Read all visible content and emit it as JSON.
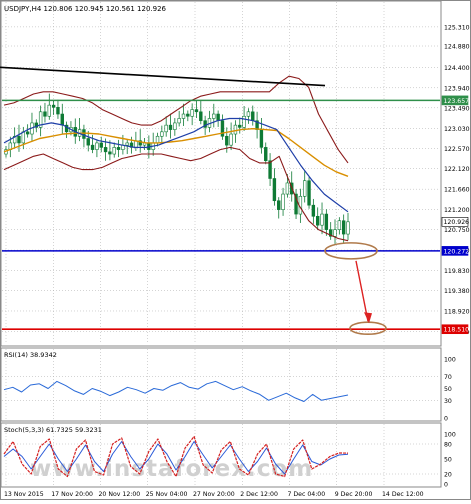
{
  "colors": {
    "background": "#ffffff",
    "grid": "#aaaaaa",
    "candle_up": "#0e7a34",
    "candle_down": "#0e7a34",
    "bollinger": "#8b1a1a",
    "ma_fast": "#1f3fa8",
    "ma_mid": "#d98f00",
    "ma_slow": "#c9a400",
    "trendline": "#000000",
    "level_green": "#2f8f4a",
    "level_blue": "#0000cc",
    "level_red": "#dd0000",
    "arrow": "#dd2222",
    "ellipse": "#b07a4a",
    "rsi_line": "#2a6ad8",
    "stoch_main": "#d42020",
    "stoch_signal": "#2a5ad8",
    "watermark": "#cfcfcf",
    "label_green_bg": "#2f8f4a",
    "label_blue_bg": "#0000cc",
    "label_red_bg": "#dd0000",
    "label_current_bg": "#ffffff"
  },
  "chart_data": [
    {
      "type": "candlestick",
      "title": "USDJPY,H4  120.806 120.945 120.561 120.926",
      "symbol": "USDJPY",
      "timeframe": "H4",
      "ohlc_last": {
        "open": 120.806,
        "high": 120.945,
        "low": 120.561,
        "close": 120.926
      },
      "ylim": [
        118.2,
        125.6
      ],
      "y_ticks": [
        125.31,
        124.88,
        124.4,
        123.94,
        123.49,
        123.03,
        122.57,
        122.12,
        121.66,
        121.2,
        120.75,
        120.29,
        119.83,
        119.38,
        118.92,
        118.46
      ],
      "x_ticks": [
        "13 Nov 2015",
        "17 Nov 20:00",
        "20 Nov 12:00",
        "25 Nov 04:00",
        "27 Nov 20:00",
        "2 Dec 12:00",
        "7 Dec 04:00",
        "9 Dec 20:00",
        "14 Dec 12:00"
      ],
      "price_labels": [
        {
          "value": "123.657",
          "style": "green"
        },
        {
          "value": "120.926",
          "style": "current"
        },
        {
          "value": "120.272",
          "style": "blue"
        },
        {
          "value": "118.510",
          "style": "red"
        }
      ],
      "levels": [
        123.657,
        120.272,
        118.51
      ],
      "trendline": [
        [
          0,
          124.4
        ],
        [
          325,
          123.99
        ]
      ],
      "closes": [
        122.55,
        122.7,
        122.85,
        122.7,
        122.95,
        122.9,
        123.15,
        123.05,
        123.4,
        123.3,
        123.55,
        123.5,
        123.35,
        123.1,
        122.95,
        123.05,
        122.85,
        123.0,
        122.8,
        122.65,
        122.55,
        122.7,
        122.6,
        122.5,
        122.45,
        122.6,
        122.55,
        122.65,
        122.7,
        122.6,
        122.75,
        122.65,
        122.7,
        122.55,
        122.7,
        122.85,
        122.95,
        123.1,
        123.0,
        123.15,
        123.25,
        123.35,
        123.3,
        123.45,
        123.4,
        123.2,
        123.05,
        123.25,
        123.35,
        123.2,
        122.85,
        122.65,
        122.9,
        123.1,
        123.05,
        123.3,
        123.4,
        123.2,
        123.0,
        122.6,
        122.3,
        121.9,
        121.4,
        121.2,
        121.55,
        121.8,
        121.55,
        121.1,
        121.5,
        121.85,
        121.3,
        121.05,
        120.85,
        121.1,
        120.75,
        120.6,
        120.75,
        120.95,
        120.65,
        120.926
      ],
      "bollinger_upper": [
        123.55,
        123.6,
        123.7,
        123.8,
        123.85,
        123.85,
        123.8,
        123.75,
        123.7,
        123.6,
        123.45,
        123.35,
        123.25,
        123.15,
        123.1,
        123.1,
        123.2,
        123.35,
        123.5,
        123.65,
        123.75,
        123.8,
        123.85,
        123.85,
        123.85,
        123.85,
        123.85,
        123.85,
        124.05,
        124.2,
        124.15,
        123.95,
        123.35,
        122.95,
        122.55,
        122.25
      ],
      "bollinger_lower": [
        122.1,
        122.2,
        122.3,
        122.4,
        122.45,
        122.35,
        122.25,
        122.15,
        122.1,
        122.1,
        122.15,
        122.25,
        122.35,
        122.4,
        122.45,
        122.45,
        122.45,
        122.4,
        122.35,
        122.3,
        122.35,
        122.45,
        122.55,
        122.6,
        122.55,
        122.35,
        122.25,
        122.25,
        122.4,
        121.85,
        121.3,
        120.95,
        120.75,
        120.65,
        120.55,
        120.5
      ],
      "ma_fast": [
        122.7,
        122.85,
        123.0,
        123.1,
        123.15,
        123.1,
        122.95,
        122.85,
        122.75,
        122.7,
        122.65,
        122.6,
        122.6,
        122.65,
        122.75,
        122.85,
        122.95,
        123.1,
        123.2,
        123.25,
        123.25,
        123.2,
        123.1,
        123.0,
        122.6,
        122.2,
        121.85,
        121.55,
        121.35,
        121.15
      ],
      "ma_mid": [
        122.5,
        122.6,
        122.7,
        122.8,
        122.85,
        122.9,
        122.92,
        122.92,
        122.9,
        122.85,
        122.8,
        122.75,
        122.7,
        122.7,
        122.72,
        122.75,
        122.8,
        122.85,
        122.9,
        122.95,
        123.0,
        123.02,
        123.0,
        122.98,
        122.8,
        122.6,
        122.4,
        122.2,
        122.05,
        121.95
      ],
      "rsi": {
        "label": "RSI(14) 38.9342",
        "ylim": [
          0,
          100
        ],
        "y_ticks": [
          100,
          70,
          50,
          30,
          0
        ],
        "values": [
          48,
          52,
          44,
          56,
          58,
          50,
          62,
          55,
          46,
          40,
          50,
          45,
          38,
          44,
          52,
          48,
          42,
          50,
          47,
          55,
          60,
          52,
          49,
          58,
          62,
          55,
          48,
          53,
          46,
          40,
          30,
          36,
          42,
          34,
          28,
          40,
          30,
          33,
          36,
          38.9342
        ]
      },
      "stochastic": {
        "label": "Stoch(5,3,3) 61.7325 59.3231",
        "ylim": [
          0,
          100
        ],
        "y_ticks": [
          100,
          80,
          50,
          20,
          0
        ],
        "main": [
          60,
          85,
          40,
          20,
          75,
          90,
          30,
          15,
          70,
          88,
          25,
          18,
          80,
          92,
          35,
          20,
          65,
          90,
          45,
          15,
          72,
          95,
          38,
          22,
          68,
          85,
          30,
          18,
          60,
          80,
          20,
          15,
          70,
          88,
          30,
          40,
          55,
          62,
          61.7325
        ],
        "signal": [
          55,
          70,
          55,
          30,
          55,
          80,
          50,
          25,
          50,
          78,
          45,
          25,
          60,
          85,
          55,
          30,
          50,
          80,
          60,
          28,
          55,
          85,
          58,
          32,
          55,
          78,
          50,
          25,
          45,
          72,
          40,
          20,
          50,
          78,
          45,
          38,
          50,
          58,
          59.3231
        ]
      }
    }
  ],
  "watermark": {
    "text": "www.instaforex.com"
  }
}
